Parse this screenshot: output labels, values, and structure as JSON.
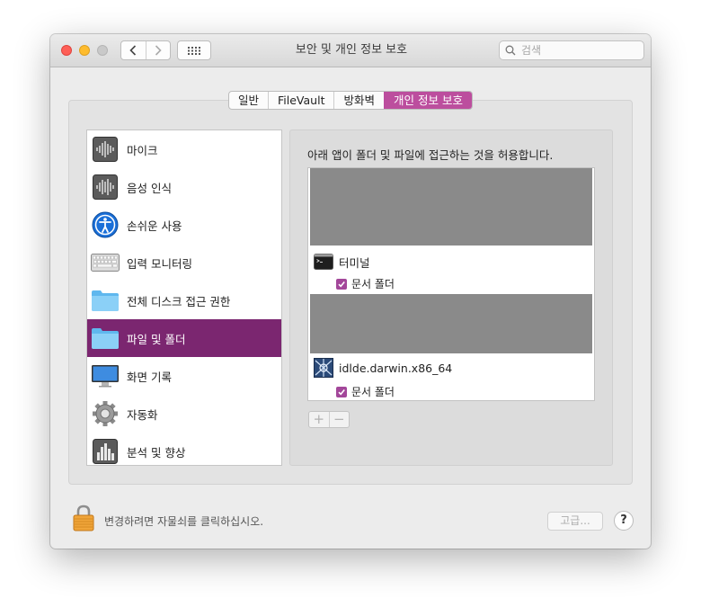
{
  "window": {
    "title": "보안 및 개인 정보 보호"
  },
  "search": {
    "placeholder": "검색"
  },
  "tabs": [
    {
      "label": "일반"
    },
    {
      "label": "FileVault"
    },
    {
      "label": "방화벽"
    },
    {
      "label": "개인 정보 보호",
      "active": true
    }
  ],
  "sidebar": {
    "items": [
      {
        "label": "마이크",
        "icon": "microphone-icon"
      },
      {
        "label": "음성 인식",
        "icon": "speech-recognition-icon"
      },
      {
        "label": "손쉬운 사용",
        "icon": "accessibility-icon"
      },
      {
        "label": "입력 모니터링",
        "icon": "keyboard-icon"
      },
      {
        "label": "전체 디스크 접근 권한",
        "icon": "folder-icon"
      },
      {
        "label": "파일 및 폴더",
        "icon": "folder-icon",
        "selected": true
      },
      {
        "label": "화면 기록",
        "icon": "display-icon"
      },
      {
        "label": "자동화",
        "icon": "gear-icon"
      },
      {
        "label": "분석 및 향상",
        "icon": "bar-chart-icon"
      }
    ]
  },
  "content": {
    "description": "아래 앱이 폴더 및 파일에 접근하는 것을 허용합니다.",
    "apps": [
      {
        "name": "터미널",
        "icon": "terminal-icon",
        "permission": "문서 폴더",
        "checked": true
      },
      {
        "name": "idlde.darwin.x86_64",
        "icon": "idle-app-icon",
        "permission": "문서 폴더",
        "checked": true
      }
    ],
    "add_label": "+",
    "remove_label": "−"
  },
  "footer": {
    "lock_text": "변경하려면 자물쇠를 클릭하십시오.",
    "advanced_label": "고급...",
    "help_label": "?"
  },
  "colors": {
    "accent": "#bc4e9e",
    "selection": "#7b2670",
    "checkbox": "#a3479a"
  }
}
